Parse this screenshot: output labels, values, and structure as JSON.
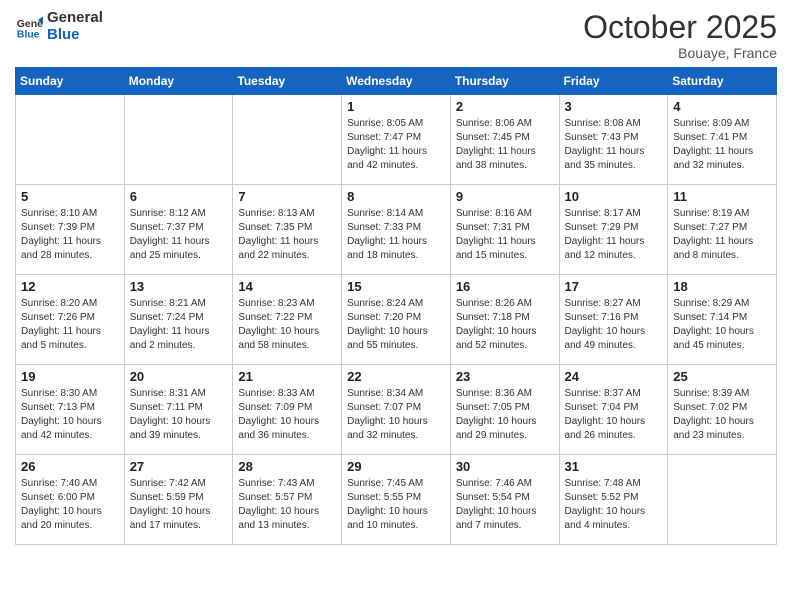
{
  "logo": {
    "line1": "General",
    "line2": "Blue"
  },
  "header": {
    "month": "October 2025",
    "location": "Bouaye, France"
  },
  "days_of_week": [
    "Sunday",
    "Monday",
    "Tuesday",
    "Wednesday",
    "Thursday",
    "Friday",
    "Saturday"
  ],
  "weeks": [
    [
      {
        "day": "",
        "info": ""
      },
      {
        "day": "",
        "info": ""
      },
      {
        "day": "",
        "info": ""
      },
      {
        "day": "1",
        "info": "Sunrise: 8:05 AM\nSunset: 7:47 PM\nDaylight: 11 hours\nand 42 minutes."
      },
      {
        "day": "2",
        "info": "Sunrise: 8:06 AM\nSunset: 7:45 PM\nDaylight: 11 hours\nand 38 minutes."
      },
      {
        "day": "3",
        "info": "Sunrise: 8:08 AM\nSunset: 7:43 PM\nDaylight: 11 hours\nand 35 minutes."
      },
      {
        "day": "4",
        "info": "Sunrise: 8:09 AM\nSunset: 7:41 PM\nDaylight: 11 hours\nand 32 minutes."
      }
    ],
    [
      {
        "day": "5",
        "info": "Sunrise: 8:10 AM\nSunset: 7:39 PM\nDaylight: 11 hours\nand 28 minutes."
      },
      {
        "day": "6",
        "info": "Sunrise: 8:12 AM\nSunset: 7:37 PM\nDaylight: 11 hours\nand 25 minutes."
      },
      {
        "day": "7",
        "info": "Sunrise: 8:13 AM\nSunset: 7:35 PM\nDaylight: 11 hours\nand 22 minutes."
      },
      {
        "day": "8",
        "info": "Sunrise: 8:14 AM\nSunset: 7:33 PM\nDaylight: 11 hours\nand 18 minutes."
      },
      {
        "day": "9",
        "info": "Sunrise: 8:16 AM\nSunset: 7:31 PM\nDaylight: 11 hours\nand 15 minutes."
      },
      {
        "day": "10",
        "info": "Sunrise: 8:17 AM\nSunset: 7:29 PM\nDaylight: 11 hours\nand 12 minutes."
      },
      {
        "day": "11",
        "info": "Sunrise: 8:19 AM\nSunset: 7:27 PM\nDaylight: 11 hours\nand 8 minutes."
      }
    ],
    [
      {
        "day": "12",
        "info": "Sunrise: 8:20 AM\nSunset: 7:26 PM\nDaylight: 11 hours\nand 5 minutes."
      },
      {
        "day": "13",
        "info": "Sunrise: 8:21 AM\nSunset: 7:24 PM\nDaylight: 11 hours\nand 2 minutes."
      },
      {
        "day": "14",
        "info": "Sunrise: 8:23 AM\nSunset: 7:22 PM\nDaylight: 10 hours\nand 58 minutes."
      },
      {
        "day": "15",
        "info": "Sunrise: 8:24 AM\nSunset: 7:20 PM\nDaylight: 10 hours\nand 55 minutes."
      },
      {
        "day": "16",
        "info": "Sunrise: 8:26 AM\nSunset: 7:18 PM\nDaylight: 10 hours\nand 52 minutes."
      },
      {
        "day": "17",
        "info": "Sunrise: 8:27 AM\nSunset: 7:16 PM\nDaylight: 10 hours\nand 49 minutes."
      },
      {
        "day": "18",
        "info": "Sunrise: 8:29 AM\nSunset: 7:14 PM\nDaylight: 10 hours\nand 45 minutes."
      }
    ],
    [
      {
        "day": "19",
        "info": "Sunrise: 8:30 AM\nSunset: 7:13 PM\nDaylight: 10 hours\nand 42 minutes."
      },
      {
        "day": "20",
        "info": "Sunrise: 8:31 AM\nSunset: 7:11 PM\nDaylight: 10 hours\nand 39 minutes."
      },
      {
        "day": "21",
        "info": "Sunrise: 8:33 AM\nSunset: 7:09 PM\nDaylight: 10 hours\nand 36 minutes."
      },
      {
        "day": "22",
        "info": "Sunrise: 8:34 AM\nSunset: 7:07 PM\nDaylight: 10 hours\nand 32 minutes."
      },
      {
        "day": "23",
        "info": "Sunrise: 8:36 AM\nSunset: 7:05 PM\nDaylight: 10 hours\nand 29 minutes."
      },
      {
        "day": "24",
        "info": "Sunrise: 8:37 AM\nSunset: 7:04 PM\nDaylight: 10 hours\nand 26 minutes."
      },
      {
        "day": "25",
        "info": "Sunrise: 8:39 AM\nSunset: 7:02 PM\nDaylight: 10 hours\nand 23 minutes."
      }
    ],
    [
      {
        "day": "26",
        "info": "Sunrise: 7:40 AM\nSunset: 6:00 PM\nDaylight: 10 hours\nand 20 minutes."
      },
      {
        "day": "27",
        "info": "Sunrise: 7:42 AM\nSunset: 5:59 PM\nDaylight: 10 hours\nand 17 minutes."
      },
      {
        "day": "28",
        "info": "Sunrise: 7:43 AM\nSunset: 5:57 PM\nDaylight: 10 hours\nand 13 minutes."
      },
      {
        "day": "29",
        "info": "Sunrise: 7:45 AM\nSunset: 5:55 PM\nDaylight: 10 hours\nand 10 minutes."
      },
      {
        "day": "30",
        "info": "Sunrise: 7:46 AM\nSunset: 5:54 PM\nDaylight: 10 hours\nand 7 minutes."
      },
      {
        "day": "31",
        "info": "Sunrise: 7:48 AM\nSunset: 5:52 PM\nDaylight: 10 hours\nand 4 minutes."
      },
      {
        "day": "",
        "info": ""
      }
    ]
  ]
}
